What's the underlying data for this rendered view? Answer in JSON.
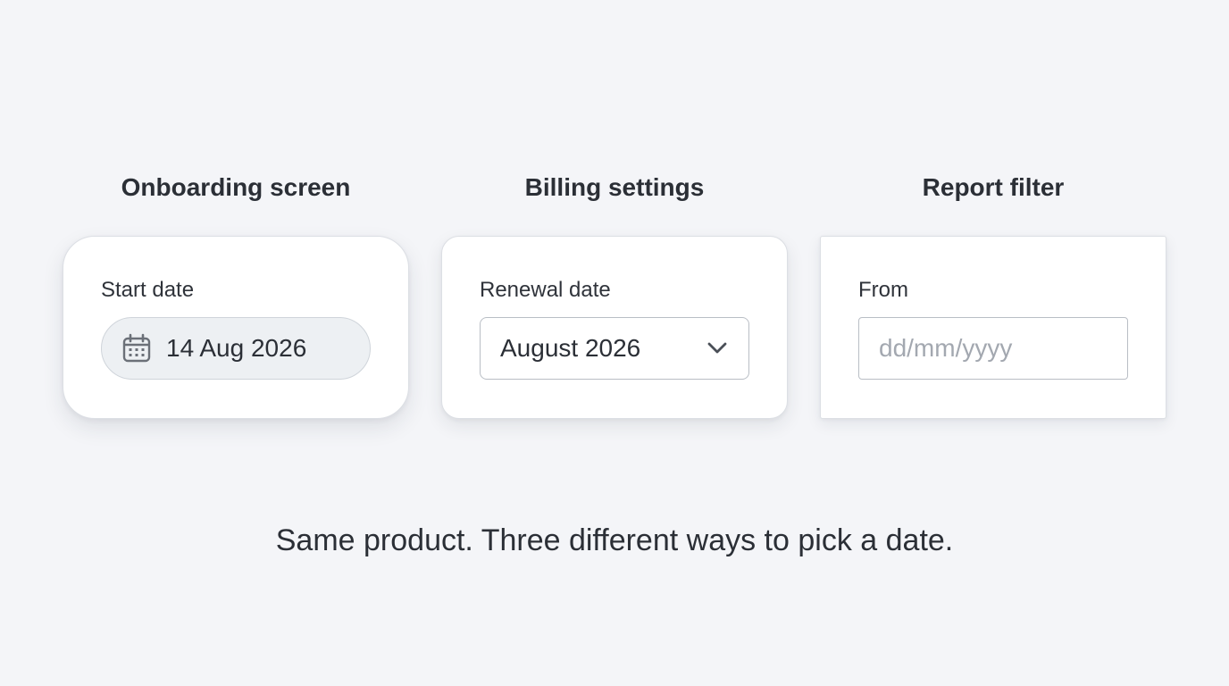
{
  "columns": [
    {
      "title": "Onboarding screen",
      "field_label": "Start date",
      "field_value": "14 Aug 2026",
      "icon": "calendar-icon"
    },
    {
      "title": "Billing settings",
      "field_label": "Renewal date",
      "field_value": "August 2026",
      "icon": "chevron-down-icon"
    },
    {
      "title": "Report filter",
      "field_label": "From",
      "field_placeholder": "dd/mm/yyyy",
      "field_value": ""
    }
  ],
  "caption": "Same product. Three different ways to pick a date.",
  "colors": {
    "background": "#f4f5f8",
    "card": "#ffffff",
    "text": "#2b2f36",
    "placeholder": "#a3a8b0",
    "pill_fill": "#edf0f3",
    "border": "#b9bec5",
    "icon": "#6b7078"
  }
}
